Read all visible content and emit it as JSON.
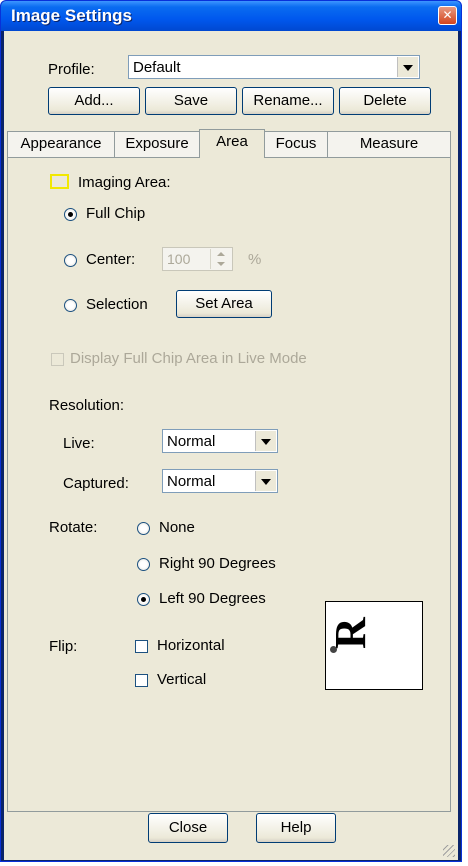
{
  "window": {
    "title": "Image Settings",
    "close_glyph": "✕"
  },
  "profile": {
    "label": "Profile:",
    "value": "Default"
  },
  "profile_buttons": {
    "add": "Add...",
    "save": "Save",
    "rename": "Rename...",
    "delete": "Delete"
  },
  "tabs": [
    {
      "label": "Appearance",
      "active": false
    },
    {
      "label": "Exposure",
      "active": false
    },
    {
      "label": "Area",
      "active": true
    },
    {
      "label": "Focus",
      "active": false
    },
    {
      "label": "Measure",
      "active": false
    }
  ],
  "imaging_area": {
    "label": "Imaging Area:",
    "swatch_color": "#f2e800",
    "full_chip": {
      "label": "Full Chip",
      "selected": true
    },
    "center": {
      "label": "Center:",
      "value": "100",
      "unit": "%",
      "selected": false,
      "disabled": true
    },
    "selection": {
      "label": "Selection",
      "selected": false,
      "button": "Set Area"
    }
  },
  "display_full_chip": {
    "label": "Display Full Chip Area in Live Mode",
    "checked": false,
    "disabled": true
  },
  "resolution": {
    "label": "Resolution:",
    "live": {
      "label": "Live:",
      "value": "Normal"
    },
    "captured": {
      "label": "Captured:",
      "value": "Normal"
    }
  },
  "rotate": {
    "label": "Rotate:",
    "options": [
      {
        "label": "None",
        "selected": false
      },
      {
        "label": "Right 90 Degrees",
        "selected": false
      },
      {
        "label": "Left 90 Degrees",
        "selected": true
      }
    ],
    "preview_letter": "R"
  },
  "flip": {
    "label": "Flip:",
    "horizontal": {
      "label": "Horizontal",
      "checked": false
    },
    "vertical": {
      "label": "Vertical",
      "checked": false
    }
  },
  "footer": {
    "close": "Close",
    "help": "Help"
  }
}
